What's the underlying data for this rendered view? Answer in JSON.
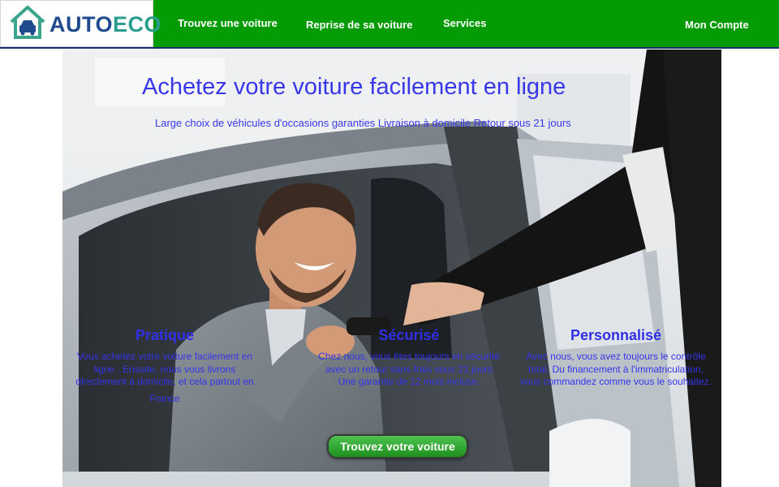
{
  "brand": {
    "part1": "AUTO",
    "part2": "ECO"
  },
  "nav": {
    "find_car": "Trouvez une voiture",
    "trade_in": "Reprise de sa voiture",
    "services": "Services",
    "account": "Mon Compte"
  },
  "hero": {
    "title": "Achetez votre voiture facilement en ligne",
    "subtitle": "Large choix de véhicules d'occasions garanties Livraison à domicile Retour sous 21 jours",
    "features": [
      {
        "title": "Pratique",
        "lines": [
          "Vous achetez votre voiture facilement en",
          "ligne . Ensuite, nous vous livrons",
          "directement à domicile, et cela partout en",
          "France"
        ]
      },
      {
        "title": "Sécurisé",
        "lines": [
          "Chez nous, vous êtes toujours en sécurité",
          "avec un retour sans frais sous 21 jours",
          "Une garantie de 12 mois incluse."
        ]
      },
      {
        "title": "Personnalisé",
        "lines": [
          "Avec nous, vous avez toujours le contrôle",
          "total. Du financement à l'immatriculation,",
          "vous commandez comme vous le souhaitez."
        ]
      }
    ],
    "cta_label": "Trouvez votre voiture"
  },
  "colors": {
    "navbar": "#049b04",
    "hero_text": "#3838e8",
    "logo_blue": "#1f4b8e",
    "logo_teal": "#2a9d8f"
  }
}
